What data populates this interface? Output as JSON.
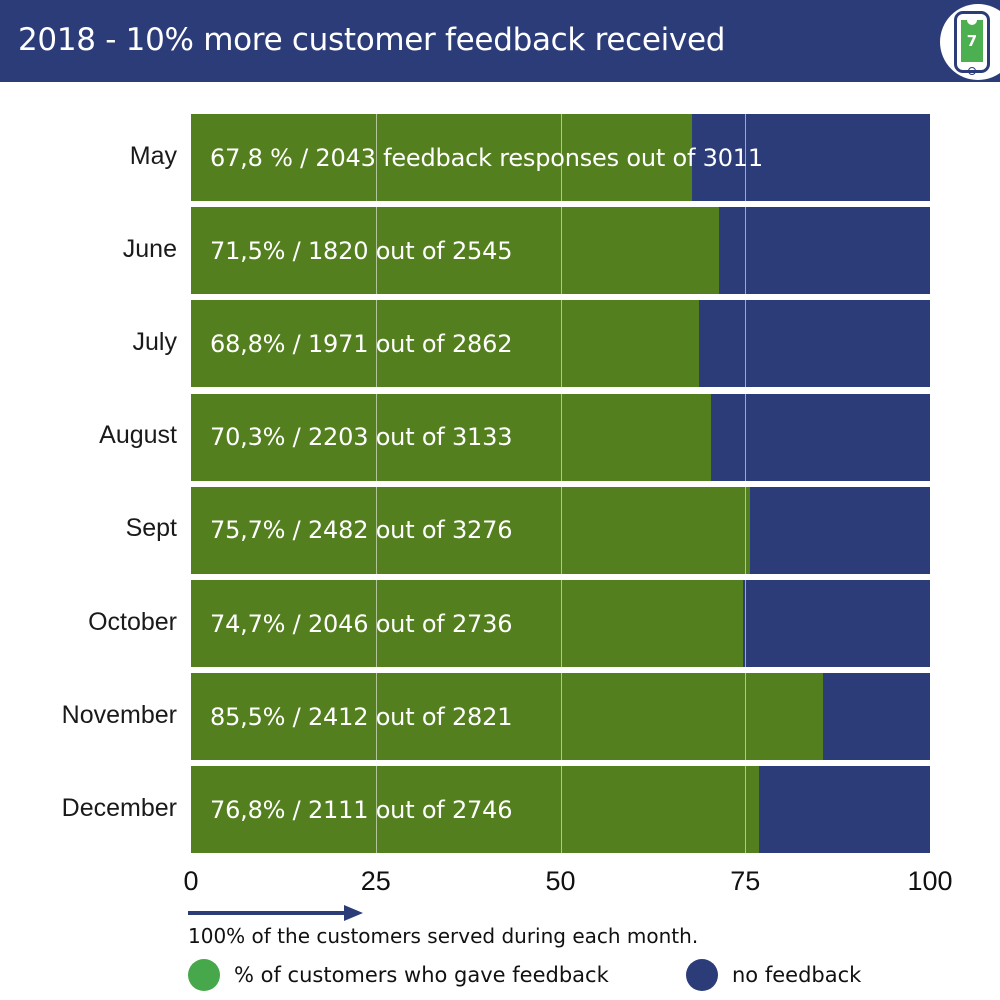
{
  "header": {
    "title": "2018 - 10% more customer feedback received",
    "banner_color": "#2B3C78",
    "logo": {
      "icon": "mobile-phone-jersey-icon",
      "number": "7",
      "jersey_color": "#4CAF50"
    }
  },
  "colors": {
    "bar_green": "#547F1F",
    "bar_navy": "#2B3C78",
    "legend_green": "#46A84B",
    "legend_navy": "#2B3C78",
    "background": "#FFFFFF"
  },
  "footer": {
    "note": "100% of the customers served during each month.",
    "arrow": "right-arrow-icon",
    "legend": [
      {
        "label": "% of customers who gave feedback",
        "color": "#46A84B"
      },
      {
        "label": "no feedback",
        "color": "#2B3C78"
      }
    ]
  },
  "chart_data": {
    "type": "bar",
    "orientation": "horizontal",
    "stacked": true,
    "title": "2018 - 10% more customer feedback received",
    "xlabel": "",
    "ylabel": "",
    "xlim": [
      0,
      100
    ],
    "ticks": [
      "0",
      "25",
      "50",
      "75",
      "100"
    ],
    "tick_values": [
      0,
      25,
      50,
      75,
      100
    ],
    "grid": true,
    "legend_position": "bottom",
    "categories": [
      "May",
      "June",
      "July",
      "August",
      "Sept",
      "October",
      "November",
      "December"
    ],
    "series": [
      {
        "name": "% of customers who gave feedback",
        "color": "#547F1F",
        "values": [
          67.8,
          71.5,
          68.8,
          70.3,
          75.7,
          74.7,
          85.5,
          76.8
        ]
      },
      {
        "name": "no feedback",
        "color": "#2B3C78",
        "values": [
          32.2,
          28.5,
          31.2,
          29.7,
          24.3,
          25.3,
          14.5,
          23.2
        ]
      }
    ],
    "rows": [
      {
        "month": "May",
        "percent": 67.8,
        "responses": 2043,
        "total": 3011,
        "label": "67,8 % / 2043 feedback responses out of 3011"
      },
      {
        "month": "June",
        "percent": 71.5,
        "responses": 1820,
        "total": 2545,
        "label": "71,5% / 1820 out of 2545"
      },
      {
        "month": "July",
        "percent": 68.8,
        "responses": 1971,
        "total": 2862,
        "label": "68,8% / 1971 out of 2862"
      },
      {
        "month": "August",
        "percent": 70.3,
        "responses": 2203,
        "total": 3133,
        "label": "70,3% / 2203 out of 3133"
      },
      {
        "month": "Sept",
        "percent": 75.7,
        "responses": 2482,
        "total": 3276,
        "label": "75,7% / 2482 out of 3276"
      },
      {
        "month": "October",
        "percent": 74.7,
        "responses": 2046,
        "total": 2736,
        "label": "74,7% / 2046 out of 2736"
      },
      {
        "month": "November",
        "percent": 85.5,
        "responses": 2412,
        "total": 2821,
        "label": "85,5% / 2412 out of 2821"
      },
      {
        "month": "December",
        "percent": 76.8,
        "responses": 2111,
        "total": 2746,
        "label": "76,8% / 2111 out of 2746"
      }
    ]
  }
}
